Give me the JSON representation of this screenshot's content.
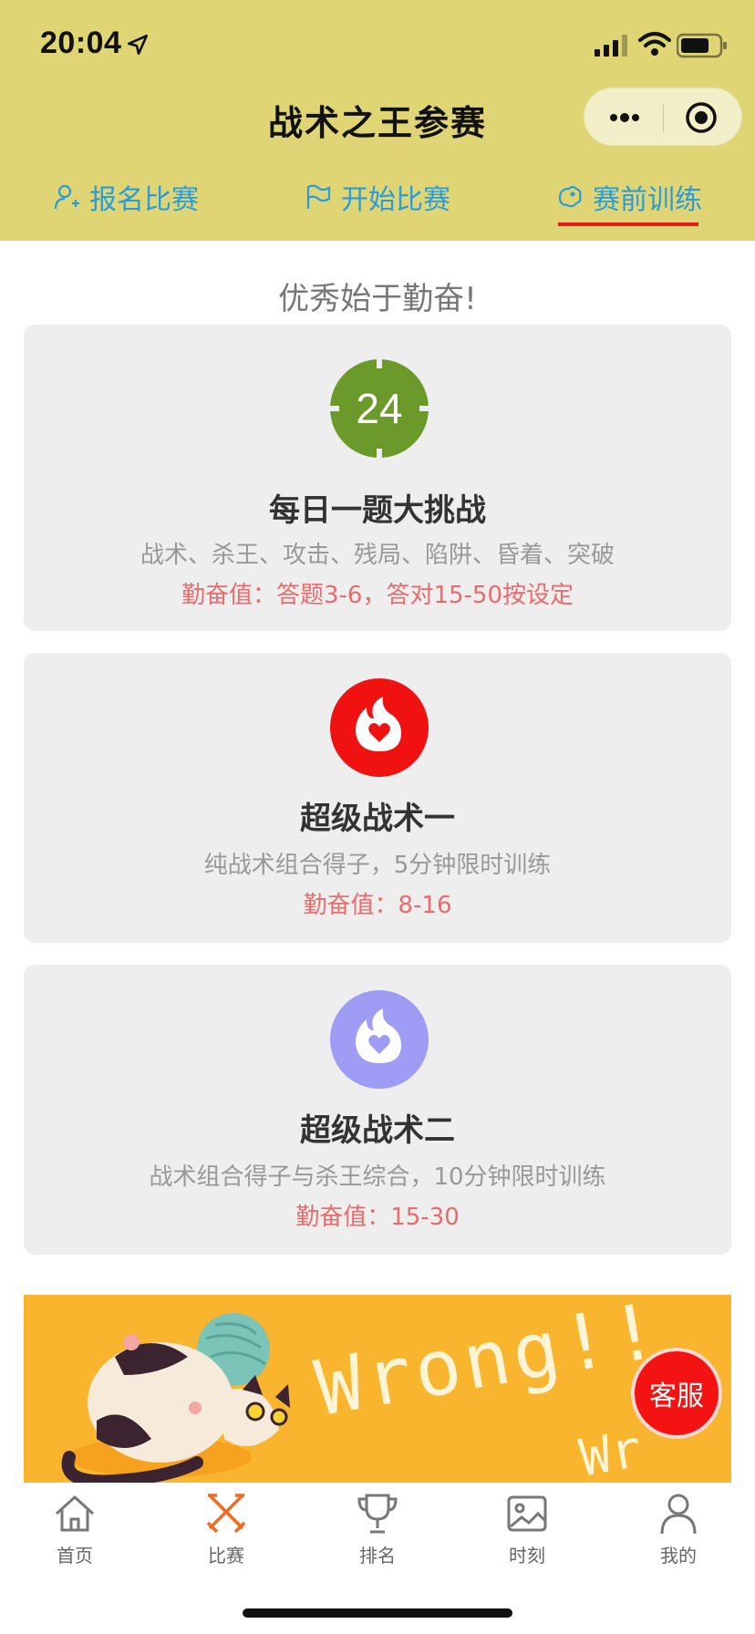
{
  "status_bar": {
    "time": "20:04"
  },
  "nav": {
    "title": "战术之王参赛"
  },
  "tabs": [
    {
      "label": "报名比赛",
      "icon": "user-plus-icon"
    },
    {
      "label": "开始比赛",
      "icon": "flag-icon"
    },
    {
      "label": "赛前训练",
      "icon": "training-icon",
      "active": true
    }
  ],
  "slogan": "优秀始于勤奋!",
  "cards": [
    {
      "icon_text": "24",
      "title": "每日一题大挑战",
      "desc": "战术、杀王、攻击、残局、陷阱、昏着、突破",
      "meta": "勤奋值：答题3-6，答对15-50按设定"
    },
    {
      "title": "超级战术一",
      "desc": "纯战术组合得子，5分钟限时训练",
      "meta": "勤奋值：8-16"
    },
    {
      "title": "超级战术二",
      "desc": "战术组合得子与杀王综合，10分钟限时训练",
      "meta": "勤奋值：15-30"
    }
  ],
  "banner": {
    "text": "Wrong!!",
    "text2": "Wr"
  },
  "service_button": "客服",
  "tabbar": [
    {
      "label": "首页",
      "icon": "home-icon"
    },
    {
      "label": "比赛",
      "icon": "swords-icon",
      "active": true
    },
    {
      "label": "排名",
      "icon": "trophy-icon"
    },
    {
      "label": "时刻",
      "icon": "photo-icon"
    },
    {
      "label": "我的",
      "icon": "profile-icon"
    }
  ],
  "colors": {
    "header_bg": "#dfd574",
    "tab_text": "#2a9cd8",
    "accent_red": "#e51b1b",
    "card_bg": "#eeeeee",
    "meta_text": "#ee6a6a",
    "banner_bg": "#f9b52d",
    "tabbar_active": "#f26a21"
  }
}
